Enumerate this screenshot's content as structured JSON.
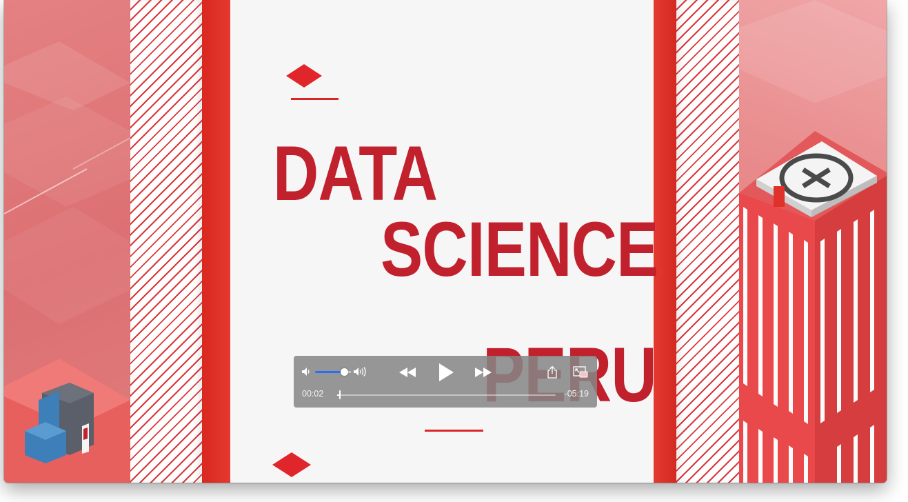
{
  "video": {
    "title_lines": [
      "DATA",
      "SCIENCE",
      "PERU"
    ],
    "accent_color": "#c1202d",
    "stripe_color": "#d9363a"
  },
  "controls": {
    "volume_low_icon": "speaker-low-icon",
    "volume_high_icon": "speaker-high-icon",
    "volume_level": 0.8,
    "rewind_icon": "rewind-icon",
    "play_icon": "play-icon",
    "forward_icon": "fast-forward-icon",
    "share_icon": "share-icon",
    "pip_icon": "picture-in-picture-icon",
    "current_time": "00:02",
    "remaining_time": "-05:19",
    "progress": 0.006,
    "slider_accent": "#2a6ef2"
  }
}
